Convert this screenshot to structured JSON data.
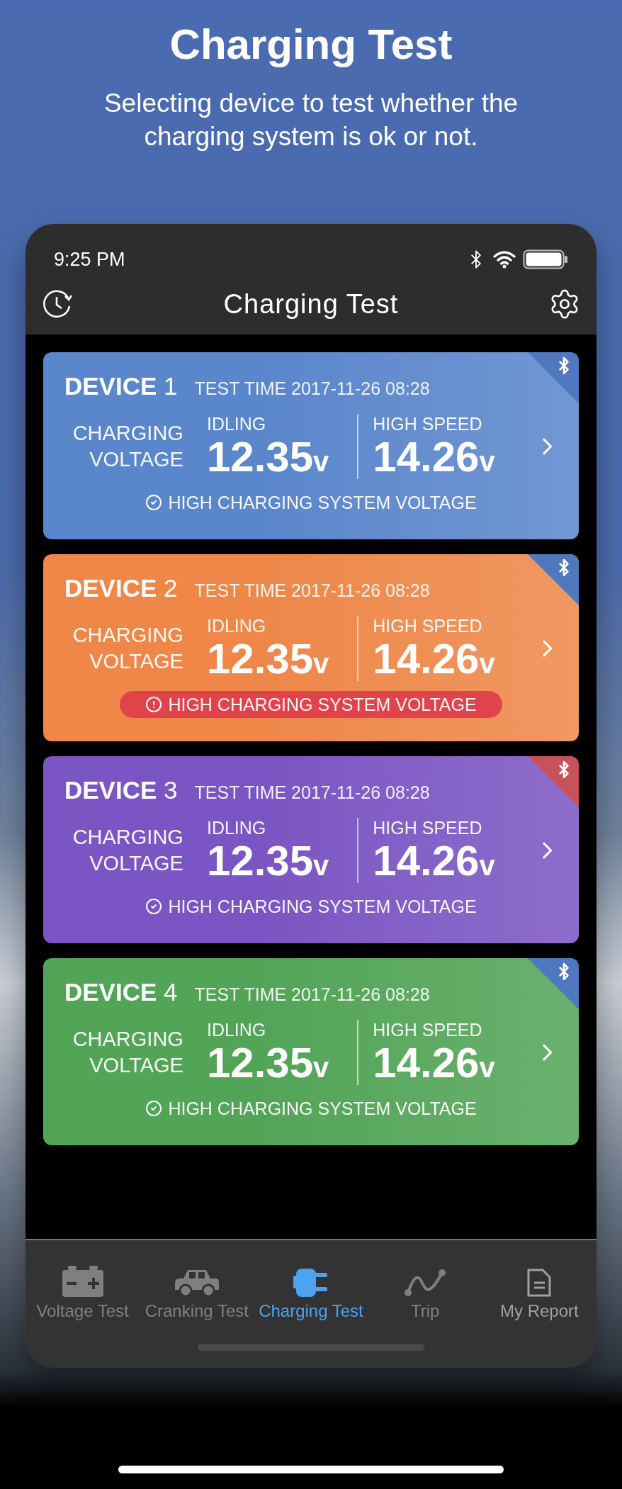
{
  "promo": {
    "title": "Charging Test",
    "subtitle": "Selecting device to test whether the charging system is ok or not."
  },
  "status_bar": {
    "time": "9:25 PM"
  },
  "nav": {
    "title": "Charging Test"
  },
  "cards": [
    {
      "name": "**DEVICE** 1",
      "test_time": "TEST TIME 2017-11-26 08:28",
      "label": "CHARGING VOLTAGE",
      "idling_label": "IDLING",
      "idling_value": "12.35",
      "idling_unit": "v",
      "high_label": "HIGH SPEED",
      "high_value": "14.26",
      "high_unit": "v",
      "status": {
        "kind": "ok",
        "text": "HIGH CHARGING SYSTEM VOLTAGE"
      },
      "color": "#5a86cc",
      "badge": {
        "color": "#4f78bf"
      }
    },
    {
      "name": "**DEVICE** 2",
      "test_time": "TEST TIME 2017-11-26 08:28",
      "label": "CHARGING VOLTAGE",
      "idling_label": "IDLING",
      "idling_value": "12.35",
      "idling_unit": "v",
      "high_label": "HIGH SPEED",
      "high_value": "14.26",
      "high_unit": "v",
      "status": {
        "kind": "warning",
        "text": "HIGH CHARGING SYSTEM VOLTAGE"
      },
      "color": "#ee8748",
      "badge": {
        "color": "#4f78bf"
      }
    },
    {
      "name": "**DEVICE** 3",
      "test_time": "TEST TIME 2017-11-26 08:28",
      "label": "CHARGING VOLTAGE",
      "idling_label": "IDLING",
      "idling_value": "12.35",
      "idling_unit": "v",
      "high_label": "HIGH SPEED",
      "high_value": "14.26",
      "high_unit": "v",
      "status": {
        "kind": "ok",
        "text": "HIGH CHARGING SYSTEM VOLTAGE"
      },
      "color": "#7b55c3",
      "badge": {
        "color": "#c8525a"
      }
    },
    {
      "name": "**DEVICE** 4",
      "test_time": "TEST TIME 2017-11-26 08:28",
      "label": "CHARGING VOLTAGE",
      "idling_label": "IDLING",
      "idling_value": "12.35",
      "idling_unit": "v",
      "high_label": "HIGH SPEED",
      "high_value": "14.26",
      "high_unit": "v",
      "status": {
        "kind": "ok",
        "text": "HIGH CHARGING SYSTEM VOLTAGE"
      },
      "color": "#52a457",
      "badge": {
        "color": "#4f78bf"
      }
    }
  ],
  "tabs": [
    {
      "kind": "battery",
      "label": "Voltage Test",
      "selected": false,
      "disabled": true
    },
    {
      "kind": "car",
      "label": "Cranking Test",
      "selected": false,
      "disabled": true
    },
    {
      "kind": "plug",
      "label": "Charging Test",
      "selected": true,
      "disabled": false
    },
    {
      "kind": "trip",
      "label": "Trip",
      "selected": false,
      "disabled": true
    },
    {
      "kind": "report",
      "label": "My Report",
      "selected": false,
      "disabled": false
    }
  ]
}
